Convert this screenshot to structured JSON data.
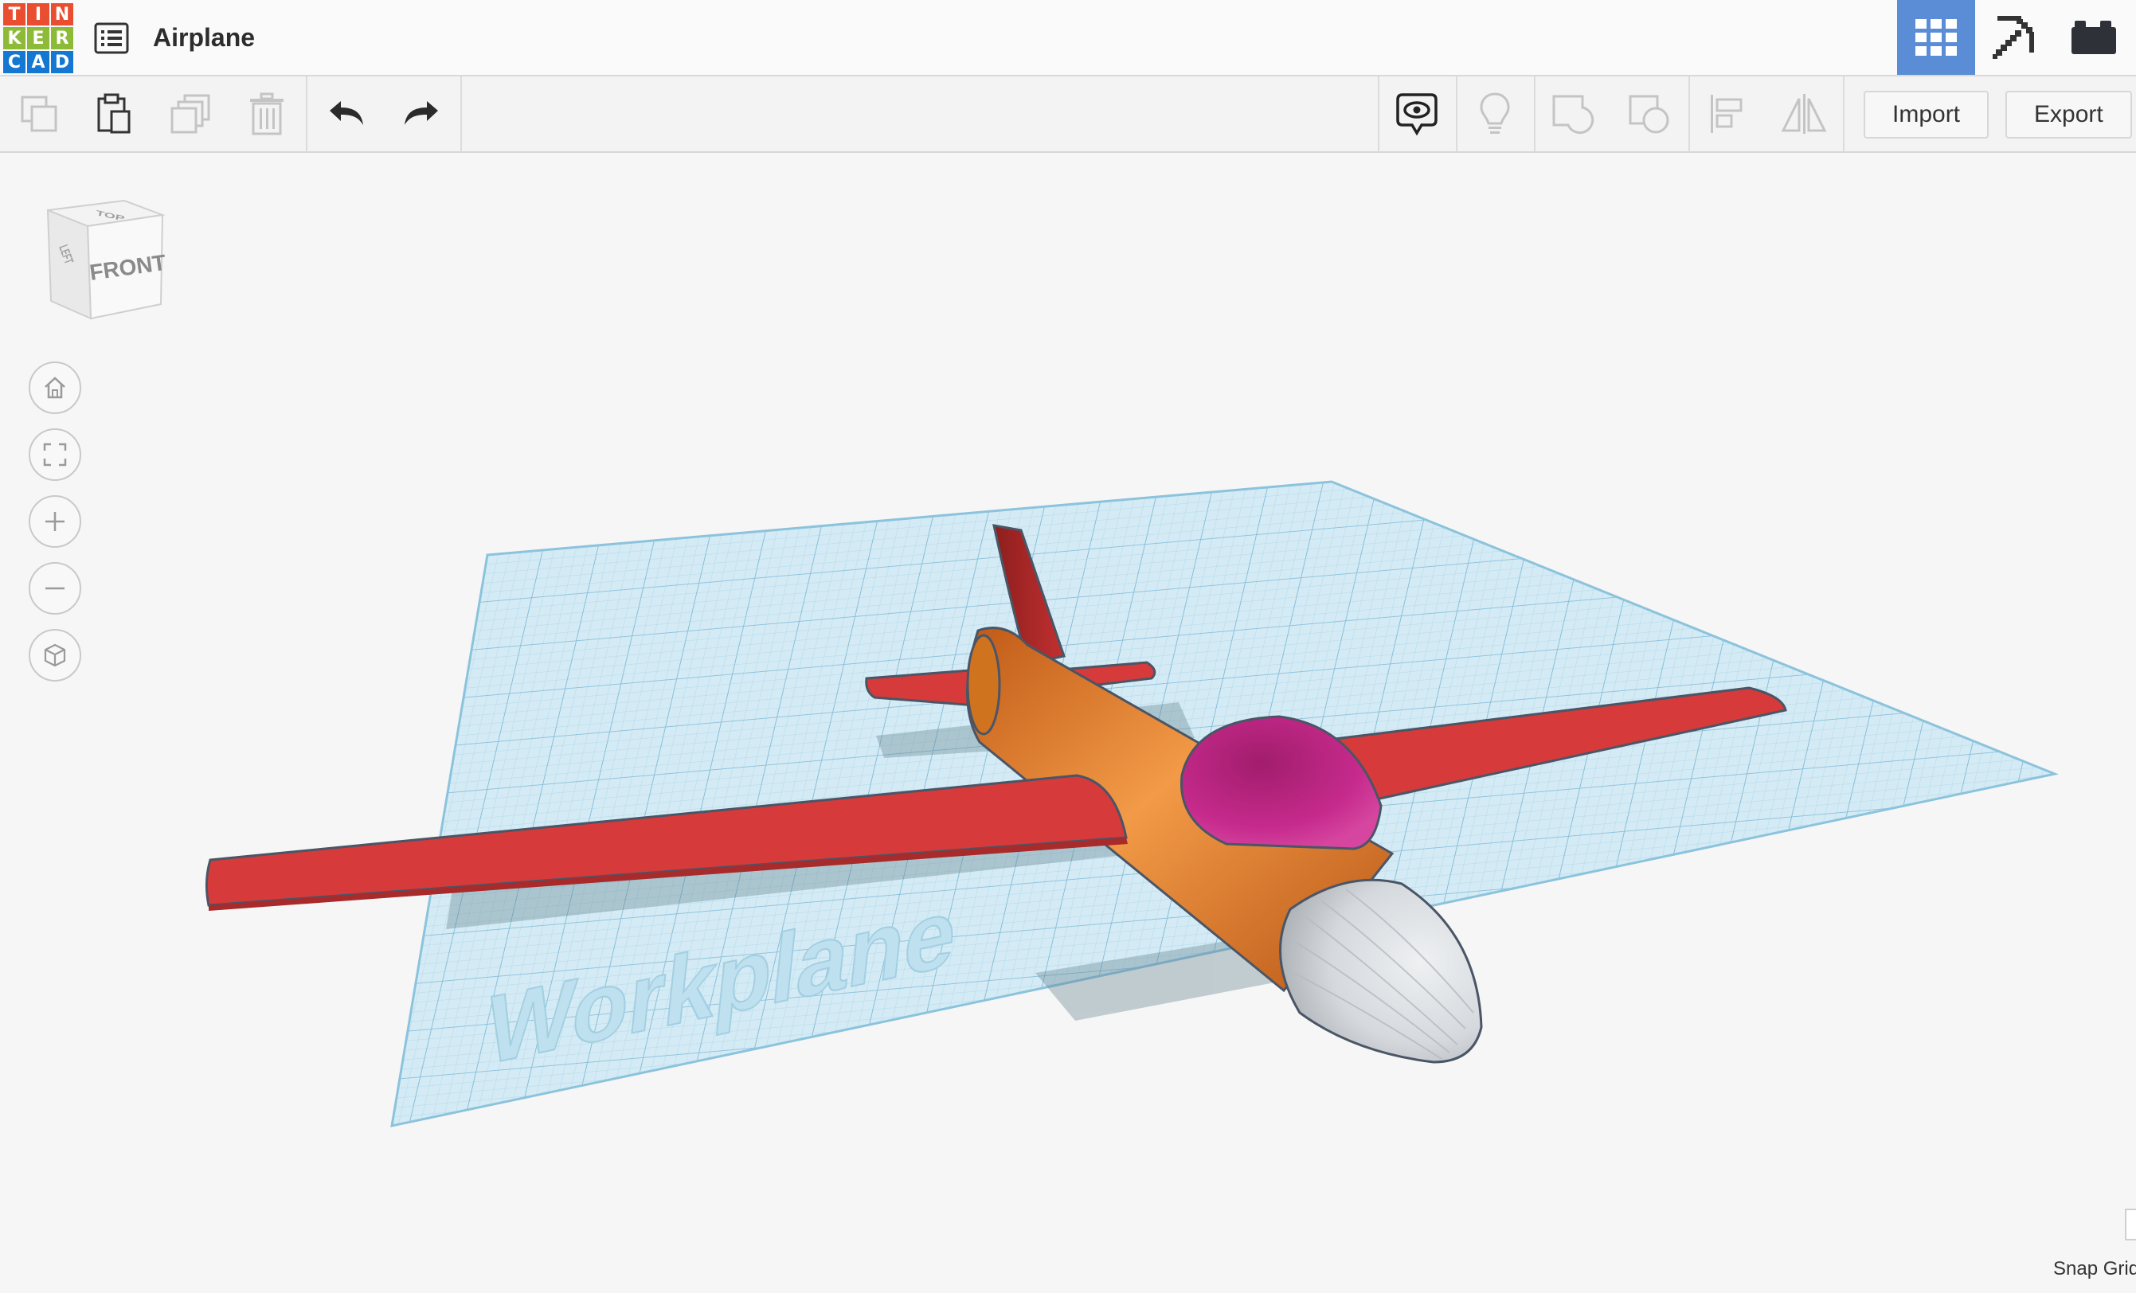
{
  "app": {
    "logo_letters": [
      "T",
      "I",
      "N",
      "K",
      "E",
      "R",
      "C",
      "A",
      "D"
    ],
    "logo_colors": [
      "#e94e31",
      "#e94e31",
      "#e94e31",
      "#8dbb37",
      "#8dbb37",
      "#8dbb37",
      "#1477d1",
      "#1477d1",
      "#1477d1"
    ],
    "design_title": "Airplane"
  },
  "header": {
    "view_buttons": [
      {
        "name": "3d-design-view",
        "icon": "grid-icon",
        "active": true
      },
      {
        "name": "blocks-view",
        "icon": "pickaxe-icon",
        "active": false
      },
      {
        "name": "bricks-view",
        "icon": "brick-icon",
        "active": false
      }
    ],
    "accent_color": "#5b8dd6"
  },
  "toolbar": {
    "left_tools": [
      "copy-icon",
      "paste-icon",
      "duplicate-icon",
      "delete-icon",
      "undo-icon",
      "redo-icon"
    ],
    "right_tools": [
      "show-all-icon",
      "notes-light-icon",
      "group-icon",
      "ungroup-icon",
      "align-icon",
      "mirror-icon"
    ],
    "import_label": "Import",
    "export_label": "Export"
  },
  "viewport": {
    "view_cube": {
      "front_label": "FRONT",
      "top_label": "TOP",
      "left_label": "LEFT"
    },
    "nav_controls": [
      "home-icon",
      "fit-view-icon",
      "zoom-in-icon",
      "zoom-out-icon",
      "ortho-view-icon"
    ],
    "workplane_label": "Workplane",
    "snap_grid_label": "Snap Grid",
    "colors": {
      "workplane": "#cfe8f3",
      "grid_line": "#8fc3dd",
      "fuselage": "#e8893a",
      "wing": "#d63a3a",
      "canopy": "#c2288a",
      "nose": "#d9dde1"
    }
  }
}
